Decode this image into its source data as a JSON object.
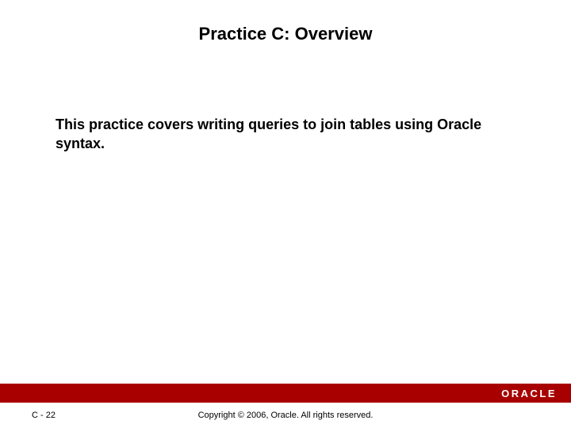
{
  "title": "Practice C: Overview",
  "body": "This practice covers writing queries to join tables using Oracle syntax.",
  "brand": "ORACLE",
  "page_number": "C - 22",
  "copyright": "Copyright © 2006, Oracle. All rights reserved."
}
